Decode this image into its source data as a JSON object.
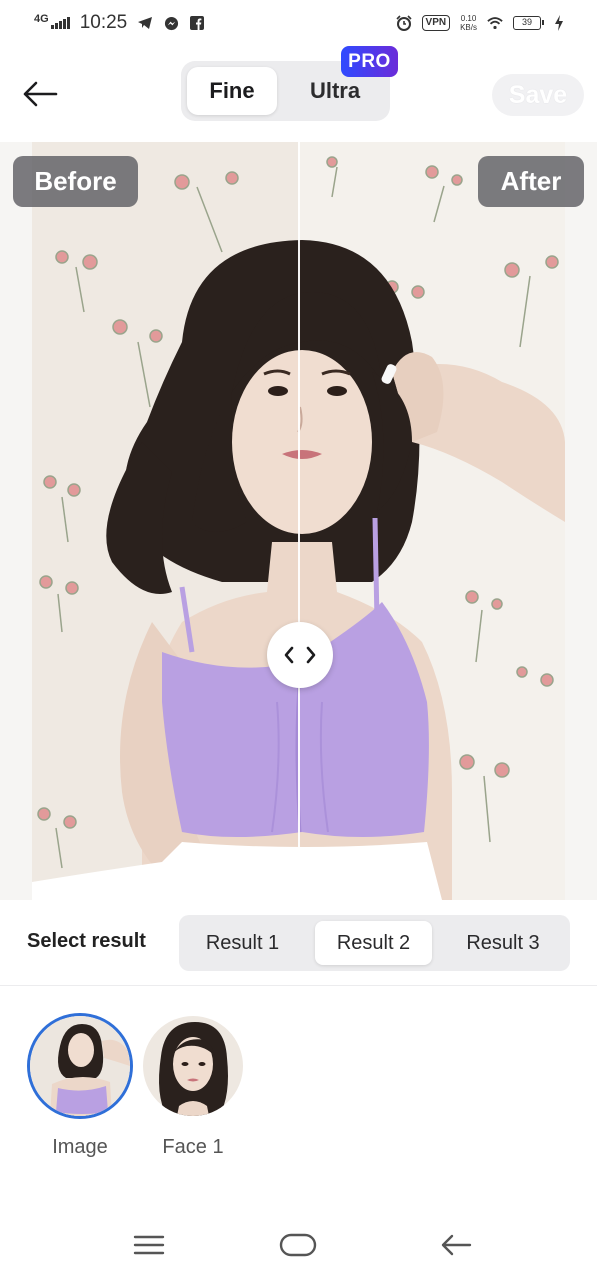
{
  "status_bar": {
    "network": "4G",
    "time": "10:25",
    "vpn": "VPN",
    "speed_value": "0.10",
    "speed_unit": "KB/s",
    "battery": "39",
    "icons": [
      "telegram-icon",
      "messenger-icon",
      "facebook-icon",
      "alarm-icon",
      "wifi-icon",
      "charging-icon"
    ]
  },
  "header": {
    "modes": [
      "Fine",
      "Ultra"
    ],
    "active_mode": "Fine",
    "pro_badge": "PRO",
    "save_label": "Save"
  },
  "compare": {
    "before_label": "Before",
    "after_label": "After",
    "divider_fraction": 0.5
  },
  "results": {
    "label": "Select result",
    "tabs": [
      "Result 1",
      "Result 2",
      "Result 3"
    ],
    "active": "Result 2"
  },
  "thumbnails": [
    {
      "label": "Image",
      "selected": true
    },
    {
      "label": "Face 1",
      "selected": false
    }
  ],
  "colors": {
    "accent_blue": "#2f6fd8",
    "pro_gradient_start": "#2f4bff",
    "pro_gradient_end": "#6b2bd9",
    "top_purple": "#b9a0e2",
    "hair": "#2a211d",
    "skin": "#ecd7c9"
  }
}
